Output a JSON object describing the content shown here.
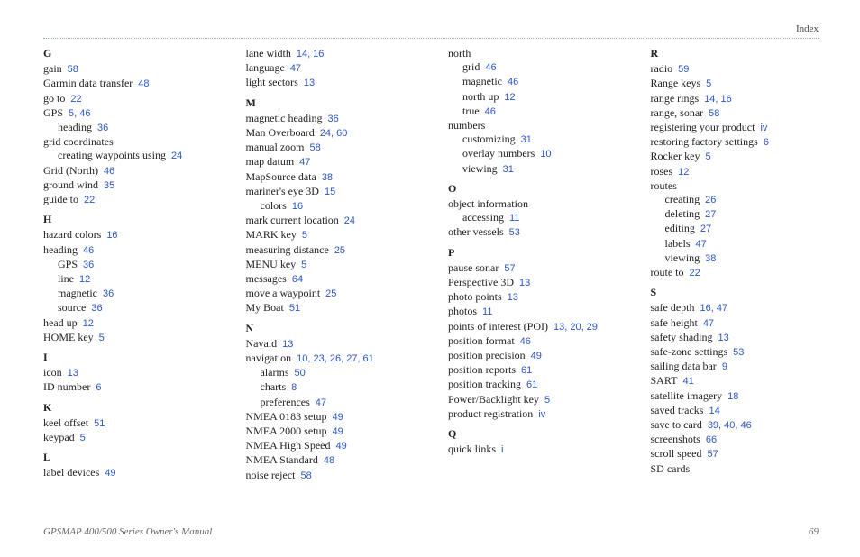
{
  "running_head": "Index",
  "footer_left": "GPSMAP 400/500 Series Owner's Manual",
  "footer_right": "69",
  "columns": [
    [
      {
        "type": "letter",
        "text": "G"
      },
      {
        "type": "entry",
        "text": "gain",
        "pages": "58"
      },
      {
        "type": "entry",
        "text": "Garmin data transfer",
        "pages": "48"
      },
      {
        "type": "entry",
        "text": "go to",
        "pages": "22"
      },
      {
        "type": "entry",
        "text": "GPS",
        "pages": "5, 46"
      },
      {
        "type": "entry",
        "indent": 1,
        "text": "heading",
        "pages": "36"
      },
      {
        "type": "entry",
        "text": "grid coordinates"
      },
      {
        "type": "entry",
        "indent": 1,
        "text": "creating waypoints using",
        "pages": "24"
      },
      {
        "type": "entry",
        "text": "Grid (North)",
        "pages": "46"
      },
      {
        "type": "entry",
        "text": "ground wind",
        "pages": "35"
      },
      {
        "type": "entry",
        "text": "guide to",
        "pages": "22"
      },
      {
        "type": "letter",
        "text": "H"
      },
      {
        "type": "entry",
        "text": "hazard colors",
        "pages": "16"
      },
      {
        "type": "entry",
        "text": "heading",
        "pages": "46"
      },
      {
        "type": "entry",
        "indent": 1,
        "text": "GPS",
        "pages": "36"
      },
      {
        "type": "entry",
        "indent": 1,
        "text": "line",
        "pages": "12"
      },
      {
        "type": "entry",
        "indent": 1,
        "text": "magnetic",
        "pages": "36"
      },
      {
        "type": "entry",
        "indent": 1,
        "text": "source",
        "pages": "36"
      },
      {
        "type": "entry",
        "text": "head up",
        "pages": "12"
      },
      {
        "type": "entry",
        "text": "HOME key",
        "pages": "5"
      },
      {
        "type": "letter",
        "text": "I"
      },
      {
        "type": "entry",
        "text": "icon",
        "pages": "13"
      },
      {
        "type": "entry",
        "text": "ID number",
        "pages": "6"
      },
      {
        "type": "letter",
        "text": "K"
      },
      {
        "type": "entry",
        "text": "keel offset",
        "pages": "51"
      },
      {
        "type": "entry",
        "text": "keypad",
        "pages": "5"
      },
      {
        "type": "letter",
        "text": "L"
      },
      {
        "type": "entry",
        "text": "label devices",
        "pages": "49"
      }
    ],
    [
      {
        "type": "entry",
        "text": "lane width",
        "pages": "14, 16"
      },
      {
        "type": "entry",
        "text": "language",
        "pages": "47"
      },
      {
        "type": "entry",
        "text": "light sectors",
        "pages": "13"
      },
      {
        "type": "letter",
        "text": "M"
      },
      {
        "type": "entry",
        "text": "magnetic heading",
        "pages": "36"
      },
      {
        "type": "entry",
        "text": "Man Overboard",
        "pages": "24, 60"
      },
      {
        "type": "entry",
        "text": "manual zoom",
        "pages": "58"
      },
      {
        "type": "entry",
        "text": "map datum",
        "pages": "47"
      },
      {
        "type": "entry",
        "text": "MapSource data",
        "pages": "38"
      },
      {
        "type": "entry",
        "text": "mariner's eye 3D",
        "pages": "15"
      },
      {
        "type": "entry",
        "indent": 1,
        "text": "colors",
        "pages": "16"
      },
      {
        "type": "entry",
        "text": "mark current location",
        "pages": "24"
      },
      {
        "type": "entry",
        "text": "MARK key",
        "pages": "5"
      },
      {
        "type": "entry",
        "text": "measuring distance",
        "pages": "25"
      },
      {
        "type": "entry",
        "text": "MENU key",
        "pages": "5"
      },
      {
        "type": "entry",
        "text": "messages",
        "pages": "64"
      },
      {
        "type": "entry",
        "text": "move a waypoint",
        "pages": "25"
      },
      {
        "type": "entry",
        "text": "My Boat",
        "pages": "51"
      },
      {
        "type": "letter",
        "text": "N"
      },
      {
        "type": "entry",
        "text": "Navaid",
        "pages": "13"
      },
      {
        "type": "entry",
        "text": "navigation",
        "pages": "10, 23, 26, 27, 61"
      },
      {
        "type": "entry",
        "indent": 1,
        "text": "alarms",
        "pages": "50"
      },
      {
        "type": "entry",
        "indent": 1,
        "text": "charts",
        "pages": "8"
      },
      {
        "type": "entry",
        "indent": 1,
        "text": "preferences",
        "pages": "47"
      },
      {
        "type": "entry",
        "text": "NMEA 0183 setup",
        "pages": "49"
      },
      {
        "type": "entry",
        "text": "NMEA 2000 setup",
        "pages": "49"
      },
      {
        "type": "entry",
        "text": "NMEA High Speed",
        "pages": "49"
      },
      {
        "type": "entry",
        "text": "NMEA Standard",
        "pages": "48"
      },
      {
        "type": "entry",
        "text": "noise reject",
        "pages": "58"
      }
    ],
    [
      {
        "type": "entry",
        "text": "north"
      },
      {
        "type": "entry",
        "indent": 1,
        "text": "grid",
        "pages": "46"
      },
      {
        "type": "entry",
        "indent": 1,
        "text": "magnetic",
        "pages": "46"
      },
      {
        "type": "entry",
        "indent": 1,
        "text": "north up",
        "pages": "12"
      },
      {
        "type": "entry",
        "indent": 1,
        "text": "true",
        "pages": "46"
      },
      {
        "type": "entry",
        "text": "numbers"
      },
      {
        "type": "entry",
        "indent": 1,
        "text": "customizing",
        "pages": "31"
      },
      {
        "type": "entry",
        "indent": 1,
        "text": "overlay numbers",
        "pages": "10"
      },
      {
        "type": "entry",
        "indent": 1,
        "text": "viewing",
        "pages": "31"
      },
      {
        "type": "letter",
        "text": "O"
      },
      {
        "type": "entry",
        "text": "object information"
      },
      {
        "type": "entry",
        "indent": 1,
        "text": "accessing",
        "pages": "11"
      },
      {
        "type": "entry",
        "text": "other vessels",
        "pages": "53"
      },
      {
        "type": "letter",
        "text": "P"
      },
      {
        "type": "entry",
        "text": "pause sonar",
        "pages": "57"
      },
      {
        "type": "entry",
        "text": "Perspective 3D",
        "pages": "13"
      },
      {
        "type": "entry",
        "text": "photo points",
        "pages": "13"
      },
      {
        "type": "entry",
        "text": "photos",
        "pages": "11"
      },
      {
        "type": "entry",
        "text": "points of interest (POI)",
        "pages": "13, 20, 29"
      },
      {
        "type": "entry",
        "text": "position format",
        "pages": "46"
      },
      {
        "type": "entry",
        "text": "position precision",
        "pages": "49"
      },
      {
        "type": "entry",
        "text": "position reports",
        "pages": "61"
      },
      {
        "type": "entry",
        "text": "position tracking",
        "pages": "61"
      },
      {
        "type": "entry",
        "text": "Power/Backlight key",
        "pages": "5"
      },
      {
        "type": "entry",
        "text": "product registration",
        "pages": "iv"
      },
      {
        "type": "letter",
        "text": "Q"
      },
      {
        "type": "entry",
        "text": "quick links",
        "pages": "i"
      }
    ],
    [
      {
        "type": "letter",
        "text": "R"
      },
      {
        "type": "entry",
        "text": "radio",
        "pages": "59"
      },
      {
        "type": "entry",
        "text": "Range keys",
        "pages": "5"
      },
      {
        "type": "entry",
        "text": "range rings",
        "pages": "14, 16"
      },
      {
        "type": "entry",
        "text": "range, sonar",
        "pages": "58"
      },
      {
        "type": "entry",
        "text": "registering your product",
        "pages": "iv"
      },
      {
        "type": "entry",
        "text": "restoring factory settings",
        "pages": "6"
      },
      {
        "type": "entry",
        "text": "Rocker key",
        "pages": "5"
      },
      {
        "type": "entry",
        "text": "roses",
        "pages": "12"
      },
      {
        "type": "entry",
        "text": "routes"
      },
      {
        "type": "entry",
        "indent": 1,
        "text": "creating",
        "pages": "26"
      },
      {
        "type": "entry",
        "indent": 1,
        "text": "deleting",
        "pages": "27"
      },
      {
        "type": "entry",
        "indent": 1,
        "text": "editing",
        "pages": "27"
      },
      {
        "type": "entry",
        "indent": 1,
        "text": "labels",
        "pages": "47"
      },
      {
        "type": "entry",
        "indent": 1,
        "text": "viewing",
        "pages": "38"
      },
      {
        "type": "entry",
        "text": "route to",
        "pages": "22"
      },
      {
        "type": "letter",
        "text": "S"
      },
      {
        "type": "entry",
        "text": "safe depth",
        "pages": "16, 47"
      },
      {
        "type": "entry",
        "text": "safe height",
        "pages": "47"
      },
      {
        "type": "entry",
        "text": "safety shading",
        "pages": "13"
      },
      {
        "type": "entry",
        "text": "safe-zone settings",
        "pages": "53"
      },
      {
        "type": "entry",
        "text": "sailing data bar",
        "pages": "9"
      },
      {
        "type": "entry",
        "text": "SART",
        "pages": "41"
      },
      {
        "type": "entry",
        "text": "satellite imagery",
        "pages": "18"
      },
      {
        "type": "entry",
        "text": "saved tracks",
        "pages": "14"
      },
      {
        "type": "entry",
        "text": "save to card",
        "pages": "39, 40, 46"
      },
      {
        "type": "entry",
        "text": "screenshots",
        "pages": "66"
      },
      {
        "type": "entry",
        "text": "scroll speed",
        "pages": "57"
      },
      {
        "type": "entry",
        "text": "SD cards"
      }
    ]
  ]
}
